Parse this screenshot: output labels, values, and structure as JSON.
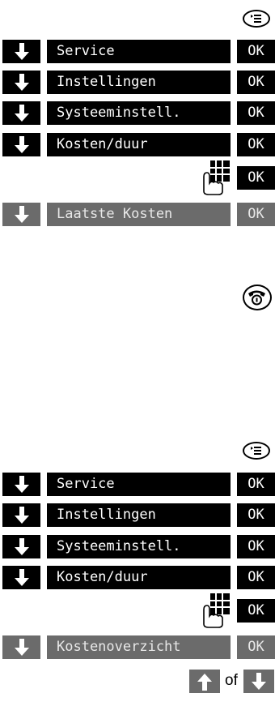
{
  "sections": [
    {
      "menu_icon": "menu-key-icon",
      "items": [
        {
          "label": "Service",
          "ok": "OK"
        },
        {
          "label": "Instellingen",
          "ok": "OK"
        },
        {
          "label": "Systeeminstell.",
          "ok": "OK"
        },
        {
          "label": "Kosten/duur",
          "ok": "OK"
        }
      ],
      "keypad_ok": "OK",
      "final": {
        "label": "Laatste Kosten",
        "ok": "OK"
      },
      "end_icon": "hang-up-key-icon"
    },
    {
      "menu_icon": "menu-key-icon",
      "items": [
        {
          "label": "Service",
          "ok": "OK"
        },
        {
          "label": "Instellingen",
          "ok": "OK"
        },
        {
          "label": "Systeeminstell.",
          "ok": "OK"
        },
        {
          "label": "Kosten/duur",
          "ok": "OK"
        }
      ],
      "keypad_ok": "OK",
      "final": {
        "label": "Kostenoverzicht",
        "ok": "OK"
      },
      "nav": {
        "connector": "of",
        "up_icon": "arrow-up-icon",
        "down_icon": "arrow-down-icon"
      }
    }
  ],
  "colors": {
    "primary": "#000000",
    "inactive": "#6b6b6b",
    "background": "#ffffff"
  }
}
